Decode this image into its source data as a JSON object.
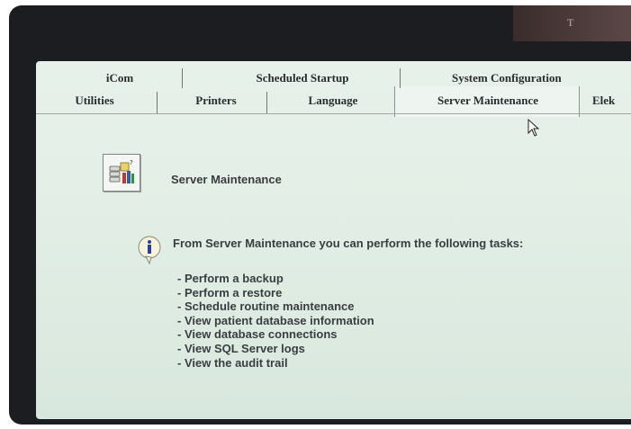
{
  "monitor": {
    "glare_text": "T"
  },
  "tabs": {
    "row1": [
      "iCom",
      "Scheduled Startup",
      "System Configuration"
    ],
    "row2": [
      "Utilities",
      "Printers",
      "Language",
      "Server Maintenance",
      "Elek"
    ],
    "active": "Server Maintenance"
  },
  "page": {
    "title": "Server Maintenance",
    "icon": "server-database-icon",
    "info_icon": "info-icon",
    "intro": "From Server Maintenance you can perform the following tasks:",
    "tasks": [
      "Perform a backup",
      "Perform a restore",
      "Schedule routine maintenance",
      "View patient database information",
      "View database connections",
      "View SQL Server logs",
      "View the audit trail"
    ]
  },
  "colors": {
    "screen_bg": "#e3efe6",
    "text": "#3a3d42",
    "bezel": "#1c1d20"
  }
}
